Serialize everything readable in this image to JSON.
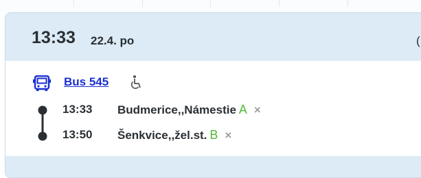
{
  "header": {
    "time": "13:33",
    "date": "22.4. po",
    "right_glyph": "("
  },
  "route": {
    "bus_label": "Bus 545",
    "icon": "bus-icon",
    "accessibility_icon": "wheelchair-icon"
  },
  "stops": [
    {
      "time": "13:33",
      "name": "Budmerice,,Námestie",
      "platform": "A",
      "remove": "×"
    },
    {
      "time": "13:50",
      "name": "Šenkvice,,žel.st.",
      "platform": "B",
      "remove": "×"
    }
  ],
  "colors": {
    "accent": "#1a2fd0",
    "platform": "#53b936",
    "header_bg": "#dcebf5",
    "text": "#2a2f33"
  }
}
